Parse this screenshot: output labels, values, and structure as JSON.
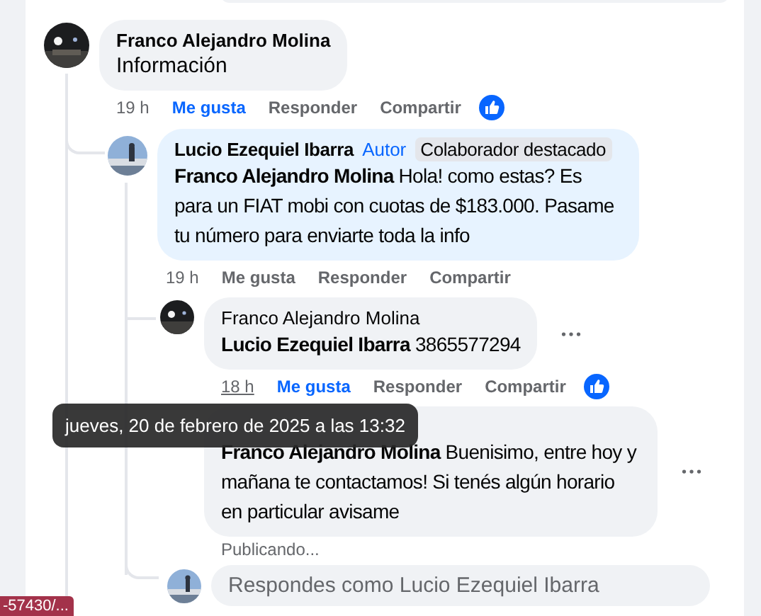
{
  "comments": [
    {
      "author": "Franco Alejandro Molina",
      "text": "Información",
      "time": "19 h",
      "time_hovered": false,
      "actions": [
        "Me gusta",
        "Responder",
        "Compartir"
      ],
      "liked": true,
      "reaction": true,
      "replies": [
        {
          "author": "Lucio Ezequiel Ibarra",
          "badges": [
            {
              "label": "Autor",
              "kind": "role"
            },
            {
              "label": "Colaborador destacado",
              "kind": "chip"
            }
          ],
          "mention": "Franco Alejandro Molina",
          "text": "Hola! como estas? Es para un FIAT mobi con cuotas de $183.000. Pasame tu número para enviarte toda la info",
          "time": "19 h",
          "time_hovered": false,
          "actions": [
            "Me gusta",
            "Responder",
            "Compartir"
          ],
          "liked": false,
          "reaction": false,
          "replies": [
            {
              "author": "Franco Alejandro Molina",
              "mention": "Lucio Ezequiel Ibarra",
              "text": "3865577294",
              "time": "18 h",
              "time_hovered": true,
              "actions": [
                "Me gusta",
                "Responder",
                "Compartir"
              ],
              "liked": true,
              "reaction": true,
              "more_menu": true
            },
            {
              "mention": "Franco Alejandro Molina",
              "text": "Buenisimo, entre hoy y mañana te contactamos! Si tenés algún horario en particular avisame",
              "status": "Publicando...",
              "more_menu": true
            }
          ],
          "reply_box": {
            "placeholder": "Respondes como Lucio Ezequiel Ibarra"
          }
        }
      ]
    }
  ],
  "tooltip": "jueves, 20 de febrero de 2025 a las 13:32",
  "status_url": "-57430/..."
}
